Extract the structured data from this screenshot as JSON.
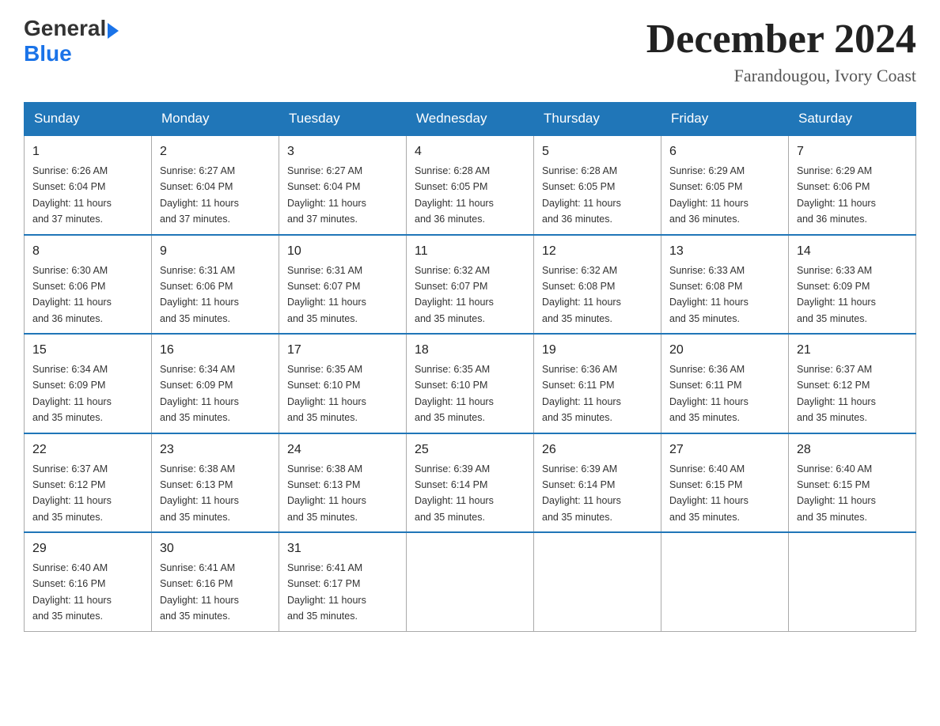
{
  "header": {
    "logo_general": "General",
    "logo_blue": "Blue",
    "month_title": "December 2024",
    "location": "Farandougou, Ivory Coast"
  },
  "days_of_week": [
    "Sunday",
    "Monday",
    "Tuesday",
    "Wednesday",
    "Thursday",
    "Friday",
    "Saturday"
  ],
  "weeks": [
    [
      {
        "day": "1",
        "sunrise": "6:26 AM",
        "sunset": "6:04 PM",
        "daylight": "11 hours and 37 minutes."
      },
      {
        "day": "2",
        "sunrise": "6:27 AM",
        "sunset": "6:04 PM",
        "daylight": "11 hours and 37 minutes."
      },
      {
        "day": "3",
        "sunrise": "6:27 AM",
        "sunset": "6:04 PM",
        "daylight": "11 hours and 37 minutes."
      },
      {
        "day": "4",
        "sunrise": "6:28 AM",
        "sunset": "6:05 PM",
        "daylight": "11 hours and 36 minutes."
      },
      {
        "day": "5",
        "sunrise": "6:28 AM",
        "sunset": "6:05 PM",
        "daylight": "11 hours and 36 minutes."
      },
      {
        "day": "6",
        "sunrise": "6:29 AM",
        "sunset": "6:05 PM",
        "daylight": "11 hours and 36 minutes."
      },
      {
        "day": "7",
        "sunrise": "6:29 AM",
        "sunset": "6:06 PM",
        "daylight": "11 hours and 36 minutes."
      }
    ],
    [
      {
        "day": "8",
        "sunrise": "6:30 AM",
        "sunset": "6:06 PM",
        "daylight": "11 hours and 36 minutes."
      },
      {
        "day": "9",
        "sunrise": "6:31 AM",
        "sunset": "6:06 PM",
        "daylight": "11 hours and 35 minutes."
      },
      {
        "day": "10",
        "sunrise": "6:31 AM",
        "sunset": "6:07 PM",
        "daylight": "11 hours and 35 minutes."
      },
      {
        "day": "11",
        "sunrise": "6:32 AM",
        "sunset": "6:07 PM",
        "daylight": "11 hours and 35 minutes."
      },
      {
        "day": "12",
        "sunrise": "6:32 AM",
        "sunset": "6:08 PM",
        "daylight": "11 hours and 35 minutes."
      },
      {
        "day": "13",
        "sunrise": "6:33 AM",
        "sunset": "6:08 PM",
        "daylight": "11 hours and 35 minutes."
      },
      {
        "day": "14",
        "sunrise": "6:33 AM",
        "sunset": "6:09 PM",
        "daylight": "11 hours and 35 minutes."
      }
    ],
    [
      {
        "day": "15",
        "sunrise": "6:34 AM",
        "sunset": "6:09 PM",
        "daylight": "11 hours and 35 minutes."
      },
      {
        "day": "16",
        "sunrise": "6:34 AM",
        "sunset": "6:09 PM",
        "daylight": "11 hours and 35 minutes."
      },
      {
        "day": "17",
        "sunrise": "6:35 AM",
        "sunset": "6:10 PM",
        "daylight": "11 hours and 35 minutes."
      },
      {
        "day": "18",
        "sunrise": "6:35 AM",
        "sunset": "6:10 PM",
        "daylight": "11 hours and 35 minutes."
      },
      {
        "day": "19",
        "sunrise": "6:36 AM",
        "sunset": "6:11 PM",
        "daylight": "11 hours and 35 minutes."
      },
      {
        "day": "20",
        "sunrise": "6:36 AM",
        "sunset": "6:11 PM",
        "daylight": "11 hours and 35 minutes."
      },
      {
        "day": "21",
        "sunrise": "6:37 AM",
        "sunset": "6:12 PM",
        "daylight": "11 hours and 35 minutes."
      }
    ],
    [
      {
        "day": "22",
        "sunrise": "6:37 AM",
        "sunset": "6:12 PM",
        "daylight": "11 hours and 35 minutes."
      },
      {
        "day": "23",
        "sunrise": "6:38 AM",
        "sunset": "6:13 PM",
        "daylight": "11 hours and 35 minutes."
      },
      {
        "day": "24",
        "sunrise": "6:38 AM",
        "sunset": "6:13 PM",
        "daylight": "11 hours and 35 minutes."
      },
      {
        "day": "25",
        "sunrise": "6:39 AM",
        "sunset": "6:14 PM",
        "daylight": "11 hours and 35 minutes."
      },
      {
        "day": "26",
        "sunrise": "6:39 AM",
        "sunset": "6:14 PM",
        "daylight": "11 hours and 35 minutes."
      },
      {
        "day": "27",
        "sunrise": "6:40 AM",
        "sunset": "6:15 PM",
        "daylight": "11 hours and 35 minutes."
      },
      {
        "day": "28",
        "sunrise": "6:40 AM",
        "sunset": "6:15 PM",
        "daylight": "11 hours and 35 minutes."
      }
    ],
    [
      {
        "day": "29",
        "sunrise": "6:40 AM",
        "sunset": "6:16 PM",
        "daylight": "11 hours and 35 minutes."
      },
      {
        "day": "30",
        "sunrise": "6:41 AM",
        "sunset": "6:16 PM",
        "daylight": "11 hours and 35 minutes."
      },
      {
        "day": "31",
        "sunrise": "6:41 AM",
        "sunset": "6:17 PM",
        "daylight": "11 hours and 35 minutes."
      },
      null,
      null,
      null,
      null
    ]
  ],
  "labels": {
    "sunrise": "Sunrise:",
    "sunset": "Sunset:",
    "daylight": "Daylight:"
  }
}
